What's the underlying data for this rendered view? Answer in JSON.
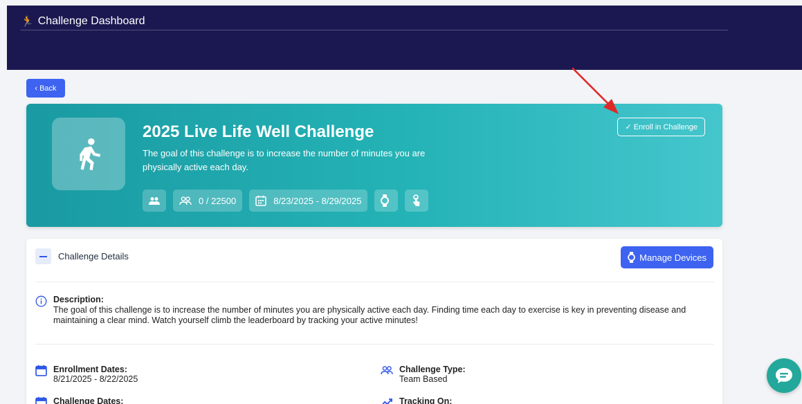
{
  "header": {
    "title": "Challenge Dashboard",
    "icon": "runner-icon"
  },
  "back_button": {
    "label": "Back"
  },
  "challenge": {
    "name": "2025 Live Life Well Challenge",
    "goal": "The goal of this challenge is to increase the number of minutes you are physically active each day.",
    "participants": "0 / 22500",
    "dates": "8/23/2025 - 8/29/2025",
    "enroll_label": "Enroll in Challenge"
  },
  "details": {
    "section_label": "Challenge Details",
    "manage_devices_label": "Manage Devices",
    "description_heading": "Description:",
    "description_text": "The goal of this challenge is to increase the number of minutes you are physically active each day. Finding time each day to exercise is key in preventing disease and maintaining a clear mind. Watch yourself climb the leaderboard by tracking your active minutes!",
    "enrollment_dates_label": "Enrollment Dates:",
    "enrollment_dates_value": "8/21/2025 - 8/22/2025",
    "challenge_type_label": "Challenge Type:",
    "challenge_type_value": "Team Based",
    "challenge_dates_label": "Challenge Dates:",
    "tracking_on_label": "Tracking On:"
  },
  "colors": {
    "header_bg": "#1b1851",
    "primary": "#3d63f0",
    "hero_gradient_start": "#1a9aa2",
    "hero_gradient_end": "#45c6cd",
    "chat_fab": "#23a89b"
  }
}
